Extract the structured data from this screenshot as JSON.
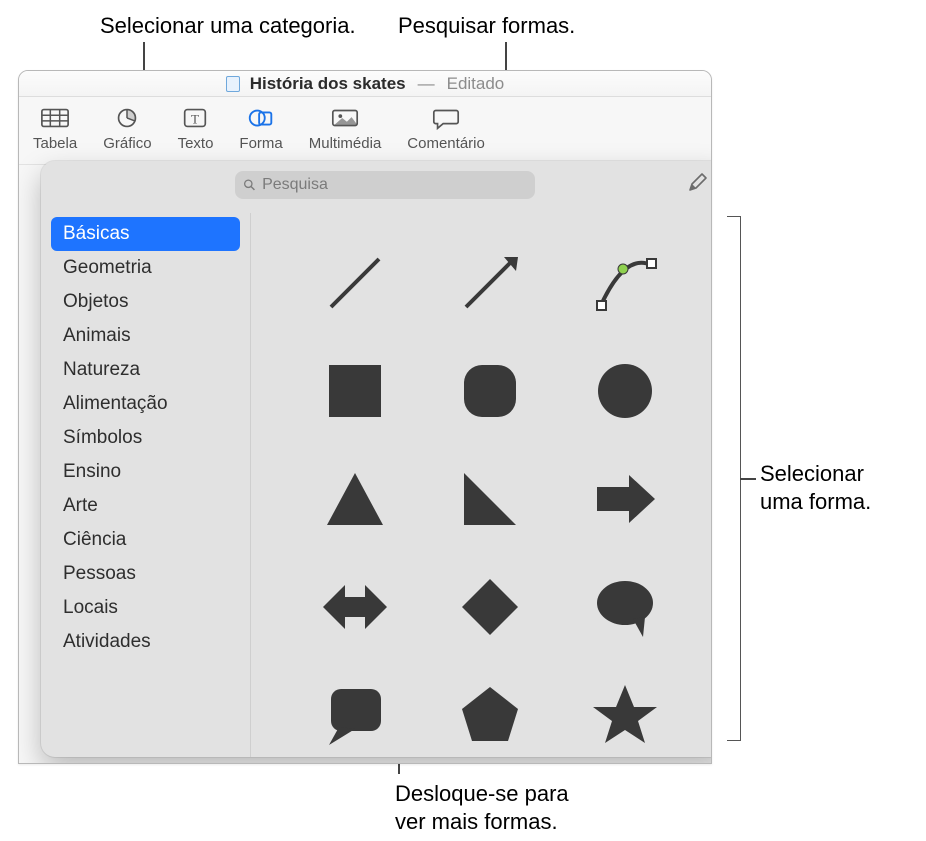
{
  "callouts": {
    "select_category": "Selecionar uma categoria.",
    "search_shapes": "Pesquisar formas.",
    "select_shape_l1": "Selecionar",
    "select_shape_l2": "uma forma.",
    "scroll_l1": "Desloque-se para",
    "scroll_l2": "ver mais formas."
  },
  "titlebar": {
    "document_name": "História dos skates",
    "edited_label": "Editado"
  },
  "toolbar": {
    "items": [
      {
        "label": "Tabela",
        "icon": "table-icon"
      },
      {
        "label": "Gráfico",
        "icon": "chart-icon"
      },
      {
        "label": "Texto",
        "icon": "text-icon"
      },
      {
        "label": "Forma",
        "icon": "shape-icon"
      },
      {
        "label": "Multimédia",
        "icon": "media-icon"
      },
      {
        "label": "Comentário",
        "icon": "comment-icon"
      }
    ]
  },
  "popover": {
    "search_placeholder": "Pesquisa",
    "categories": [
      "Básicas",
      "Geometria",
      "Objetos",
      "Animais",
      "Natureza",
      "Alimentação",
      "Símbolos",
      "Ensino",
      "Arte",
      "Ciência",
      "Pessoas",
      "Locais",
      "Atividades"
    ],
    "shapes": [
      "line",
      "arrow-line",
      "curve",
      "square",
      "rounded-square",
      "circle",
      "triangle",
      "right-triangle",
      "arrow-right",
      "arrow-bidir",
      "diamond",
      "speech-bubble",
      "callout-square",
      "pentagon",
      "star"
    ]
  }
}
